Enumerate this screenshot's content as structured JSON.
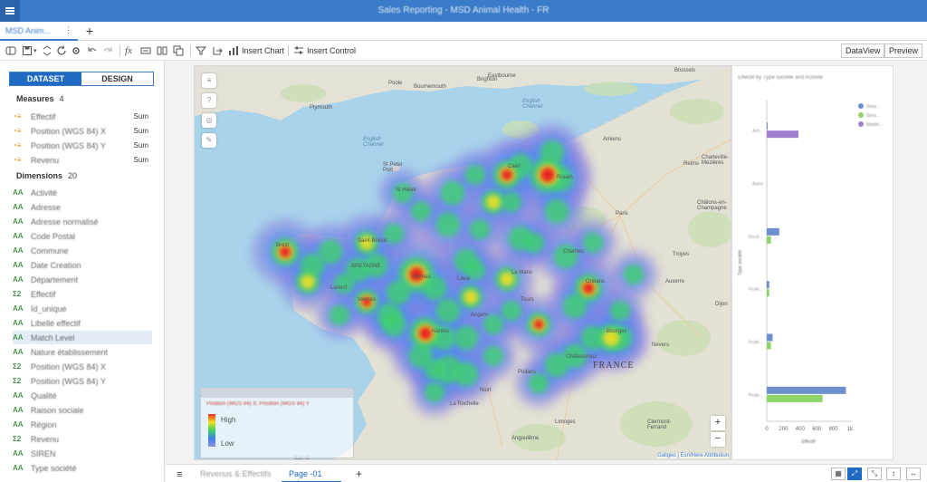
{
  "app": {
    "title": "Sales Reporting - MSD Animal Health - FR",
    "doc_tab": "MSD Anim...",
    "doc_tab_menu": "⋮",
    "add_tab": "+"
  },
  "toolbar": {
    "insert_chart": "Insert Chart",
    "insert_control": "Insert Control",
    "dataview": "DataView",
    "preview": "Preview",
    "fx": "fx"
  },
  "left_panel": {
    "tabs": [
      "DATASET",
      "DESIGN"
    ],
    "measures_label": "Measures",
    "measures_count": "4",
    "measures": [
      {
        "name": "Effectif",
        "agg": "Sum"
      },
      {
        "name": "Position (WGS 84) X",
        "agg": "Sum"
      },
      {
        "name": "Position (WGS 84) Y",
        "agg": "Sum"
      },
      {
        "name": "Revenu",
        "agg": "Sum"
      }
    ],
    "dimensions_label": "Dimensions",
    "dimensions_count": "20",
    "dimensions": [
      {
        "icon": "AA",
        "name": "Activité"
      },
      {
        "icon": "AA",
        "name": "Adresse"
      },
      {
        "icon": "AA",
        "name": "Adresse normalisé"
      },
      {
        "icon": "AA",
        "name": "Code Postal"
      },
      {
        "icon": "AA",
        "name": "Commune"
      },
      {
        "icon": "AA",
        "name": "Date Creation"
      },
      {
        "icon": "AA",
        "name": "Département"
      },
      {
        "icon": "Σ2",
        "name": "Effectif"
      },
      {
        "icon": "AA",
        "name": "Id_unique"
      },
      {
        "icon": "AA",
        "name": "Libellé effectif"
      },
      {
        "icon": "AA",
        "name": "Match Level"
      },
      {
        "icon": "AA",
        "name": "Nature établissement"
      },
      {
        "icon": "Σ2",
        "name": "Position (WGS 84) X"
      },
      {
        "icon": "Σ2",
        "name": "Position (WGS 84) Y"
      },
      {
        "icon": "AA",
        "name": "Qualité"
      },
      {
        "icon": "AA",
        "name": "Raison sociale"
      },
      {
        "icon": "AA",
        "name": "Région"
      },
      {
        "icon": "Σ2",
        "name": "Revenu"
      },
      {
        "icon": "AA",
        "name": "SIREN"
      },
      {
        "icon": "AA",
        "name": "Type société"
      }
    ],
    "highlighted_index": 10
  },
  "map": {
    "labels": {
      "brussels": "Brussels",
      "bournemouth": "Bournemouth",
      "brighton": "Brighton",
      "eastbourne": "Eastbourne",
      "plymouth": "Plymouth",
      "poole": "Poole",
      "english_channel_1": "English\nChannel",
      "english_channel_2": "English\nChannel",
      "st_peter_port": "St Peter\nPort",
      "st_helier": "St Helier",
      "amiens": "Amiens",
      "paris": "Paris",
      "france": "FRANCE",
      "nantes": "Nantes",
      "poitiers": "Poitiers",
      "niort": "Niort",
      "la_rochelle": "La Rochelle",
      "limoges": "Limoges",
      "clermont": "Clermont-\nFerrand",
      "angouleme": "Angoulême",
      "chateauroux": "Châteauroux",
      "chartres": "Chartres",
      "tours": "Tours",
      "le_mans": "Le Mans",
      "rennes": "Rennes",
      "caen": "Caen",
      "rouen": "Rouen",
      "reims": "Reims",
      "troyes": "Troyes",
      "orleans": "Orléans",
      "nevers": "Nevers",
      "bourges": "Bourges",
      "dijon": "Dijon",
      "bay_of": "Bay of",
      "brest": "Brest",
      "angers": "Angers",
      "vannes": "Vannes",
      "laval": "Laval",
      "lorient": "Lorient",
      "saint_brieuc": "Saint-Brieuc",
      "auxerre": "Auxerre",
      "bretagne": "BRETAGNE",
      "charleville": "Charleville-\nMézières",
      "chalons": "Châlons-en-\nChampagne"
    },
    "legend": {
      "title": "Position (WGS 84) X, Position (WGS 84) Y",
      "high": "High",
      "low": "Low"
    },
    "zoom_in": "+",
    "zoom_out": "−",
    "attribution": "Galigeo | Esri/Here Attribution"
  },
  "chart_data": {
    "type": "bar",
    "title": "Effectif by Type société and Activité",
    "xlabel": "Effectif",
    "ylabel": "Type société",
    "xlim": [
      0,
      1000
    ],
    "xticks": [
      "0",
      "200",
      "400",
      "600",
      "800",
      "1k"
    ],
    "categories": [
      "Arti...",
      "Autre",
      "Socié...",
      "Profe...",
      "Profe...",
      "Profe..."
    ],
    "series": [
      {
        "name": "Gros...",
        "color": "#6d8fd0",
        "values": [
          10,
          0,
          150,
          30,
          70,
          950
        ]
      },
      {
        "name": "Gros...",
        "color": "#8ed46a",
        "values": [
          0,
          0,
          50,
          30,
          50,
          670
        ]
      },
      {
        "name": "Matéri...",
        "color": "#9f7ed0",
        "values": [
          380,
          0,
          0,
          0,
          0,
          0
        ]
      }
    ]
  },
  "bottom": {
    "page_tab_1": "Revenus & Effectifs",
    "page_tab_2": "Page -01",
    "page_tab_menu": "⋮",
    "add_page": "+"
  },
  "colors": {
    "accent": "#3a7cc9",
    "title_bar": "#3a7cc9",
    "selected": "#1f6bc3"
  }
}
